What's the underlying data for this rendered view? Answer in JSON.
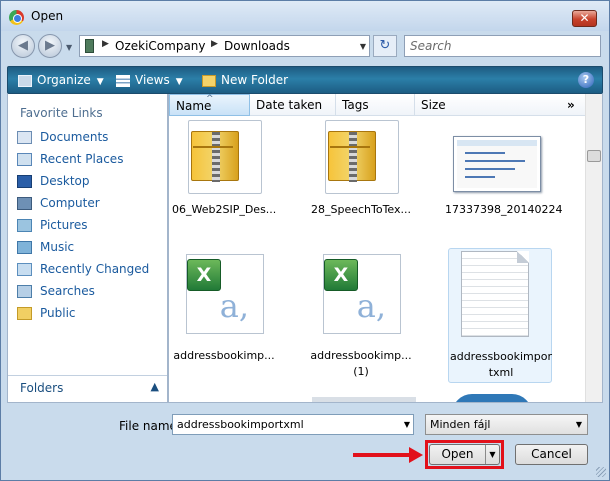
{
  "window": {
    "title": "Open",
    "close_glyph": "✕"
  },
  "nav": {
    "back_glyph": "◀",
    "forward_glyph": "▶",
    "breadcrumb": [
      "OzekiCompany",
      "Downloads"
    ],
    "refresh_glyph": "↻",
    "search_placeholder": "Search"
  },
  "toolbar": {
    "organize": "Organize",
    "views": "Views",
    "new_folder": "New Folder",
    "help": "?"
  },
  "sidebar": {
    "favorites_title": "Favorite Links",
    "items": [
      {
        "label": "Documents",
        "icon": "documents-icon"
      },
      {
        "label": "Recent Places",
        "icon": "recent-places-icon"
      },
      {
        "label": "Desktop",
        "icon": "desktop-icon"
      },
      {
        "label": "Computer",
        "icon": "computer-icon"
      },
      {
        "label": "Pictures",
        "icon": "pictures-icon"
      },
      {
        "label": "Music",
        "icon": "music-icon"
      },
      {
        "label": "Recently Changed",
        "icon": "recently-changed-icon"
      },
      {
        "label": "Searches",
        "icon": "searches-icon"
      },
      {
        "label": "Public",
        "icon": "public-icon"
      }
    ],
    "folders_label": "Folders",
    "folders_toggle": "▲"
  },
  "columns": {
    "name": "Name",
    "date": "Date taken",
    "tags": "Tags",
    "size": "Size",
    "more": "»"
  },
  "files": [
    {
      "label": "06_Web2SIP_Des...",
      "type": "zip"
    },
    {
      "label": "28_SpeechToTex...",
      "type": "zip"
    },
    {
      "label": "17337398_20140224",
      "type": "image"
    },
    {
      "label": "addressbookimp...",
      "type": "excel"
    },
    {
      "label": "addressbookimp... (1)",
      "type": "excel"
    },
    {
      "label": "addressbookimpor txml",
      "type": "text",
      "selected": true
    }
  ],
  "form": {
    "filename_label": "File name:",
    "filename_value": "addressbookimportxml",
    "filetype_value": "Minden fájl",
    "open_label": "Open",
    "cancel_label": "Cancel"
  },
  "colors": {
    "annotation": "#e2111b",
    "toolbar": "#2b7fa8",
    "link": "#1a5a9e"
  }
}
